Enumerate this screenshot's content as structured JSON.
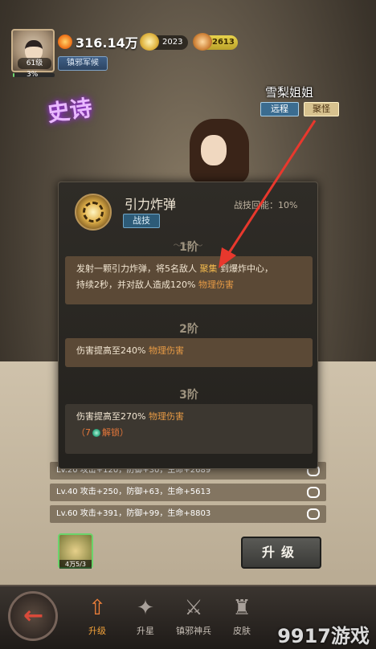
{
  "player": {
    "level": "61级",
    "exp_percent": "3%",
    "exp_fraction": 0.03,
    "power": "316.14万",
    "title": "镇邪军候",
    "currency1": "2023",
    "currency2": "2613"
  },
  "hero": {
    "name": "雪梨姐姐",
    "range_tag": "远程",
    "group_tag": "聚怪",
    "rarity": "史诗"
  },
  "skill": {
    "name": "引力炸弹",
    "type": "战技",
    "energy": "战技回能：10%",
    "tiers": [
      {
        "label": "1阶",
        "line1_a": "发射一颗引力炸弹，将5名敌人",
        "line1_hl": "聚集",
        "line1_b": "到爆炸中心，",
        "line2_a": "持续2秒，并对敌人造成120%",
        "line2_hl": "物理伤害"
      },
      {
        "label": "2阶",
        "text_a": "伤害提高至240%",
        "text_hl": "物理伤害"
      },
      {
        "label": "3阶",
        "text_a": "伤害提高至270%",
        "text_hl": "物理伤害",
        "lock_a": "（7",
        "lock_b": "解锁）"
      }
    ]
  },
  "stat_rows": [
    "Lv.20 攻击+120，防御+30，生命+2689",
    "Lv.40 攻击+250，防御+63，生命+5613",
    "Lv.60 攻击+391，防御+99，生命+8803"
  ],
  "upgrade": {
    "item_count": "4万5/3",
    "button_label": "升级"
  },
  "nav": {
    "items": [
      "升级",
      "升星",
      "镇邪神兵",
      "皮肤"
    ]
  },
  "watermark": "9917游戏",
  "colors": {
    "accent": "#f2813a",
    "highlight": "#f0b84d",
    "arrow": "#e8382d"
  }
}
